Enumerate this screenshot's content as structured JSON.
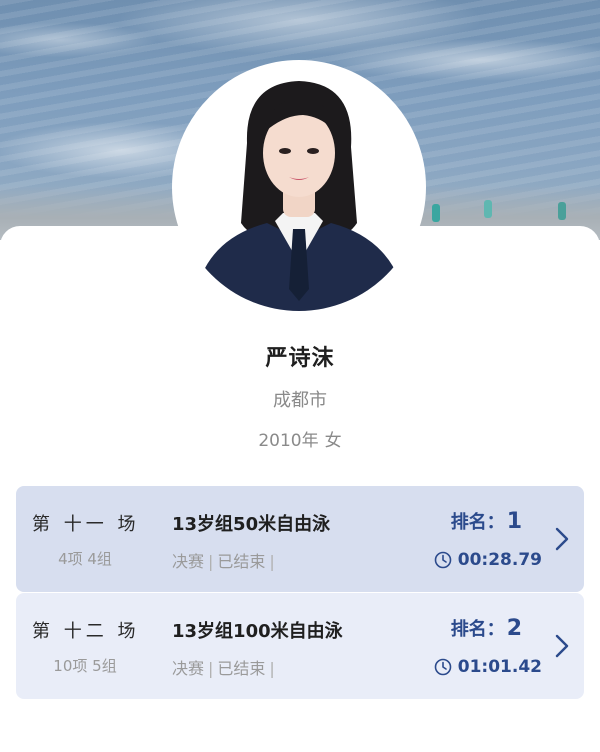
{
  "profile": {
    "name": "严诗沫",
    "city": "成都市",
    "birth_year": "2010年",
    "gender": "女"
  },
  "results": [
    {
      "round": "第 十一 场",
      "group_info": "4项 4组",
      "event": "13岁组50米自由泳",
      "stage": "决赛",
      "status": "已结束",
      "rank_label": "排名：",
      "rank": "1",
      "time": "00:28.79"
    },
    {
      "round": "第 十二 场",
      "group_info": "10项 5组",
      "event": "13岁组100米自由泳",
      "stage": "决赛",
      "status": "已结束",
      "rank_label": "排名：",
      "rank": "2",
      "time": "01:01.42"
    }
  ],
  "icons": {
    "clock": "clock-icon",
    "chevron": "chevron-right-icon"
  },
  "colors": {
    "accent": "#2b4a8c",
    "row1_bg": "#d7deef",
    "row2_bg": "#e9edf8"
  }
}
